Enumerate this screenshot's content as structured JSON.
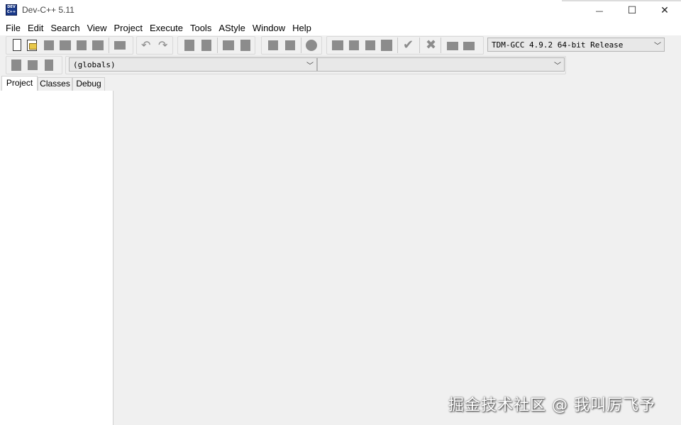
{
  "window": {
    "title": "Dev-C++ 5.11",
    "app_icon_text": "DEV C++",
    "controls": {
      "minimize": "—",
      "maximize": "☐",
      "close": "✕"
    }
  },
  "menubar": {
    "items": [
      "File",
      "Edit",
      "Search",
      "View",
      "Project",
      "Execute",
      "Tools",
      "AStyle",
      "Window",
      "Help"
    ]
  },
  "toolbar": {
    "compiler_select": "TDM-GCC 4.9.2 64-bit Release",
    "scope_select": "(globals)",
    "function_select": ""
  },
  "left_panel": {
    "tabs": [
      "Project",
      "Classes",
      "Debug"
    ],
    "active_tab": "Project"
  },
  "watermark": "掘金技术社区 @ 我叫厉飞予",
  "colors": {
    "background": "#f0f0f0",
    "panel": "#ffffff",
    "icon_gray": "#8c8c8c",
    "app_icon": "#1a3a8a"
  }
}
